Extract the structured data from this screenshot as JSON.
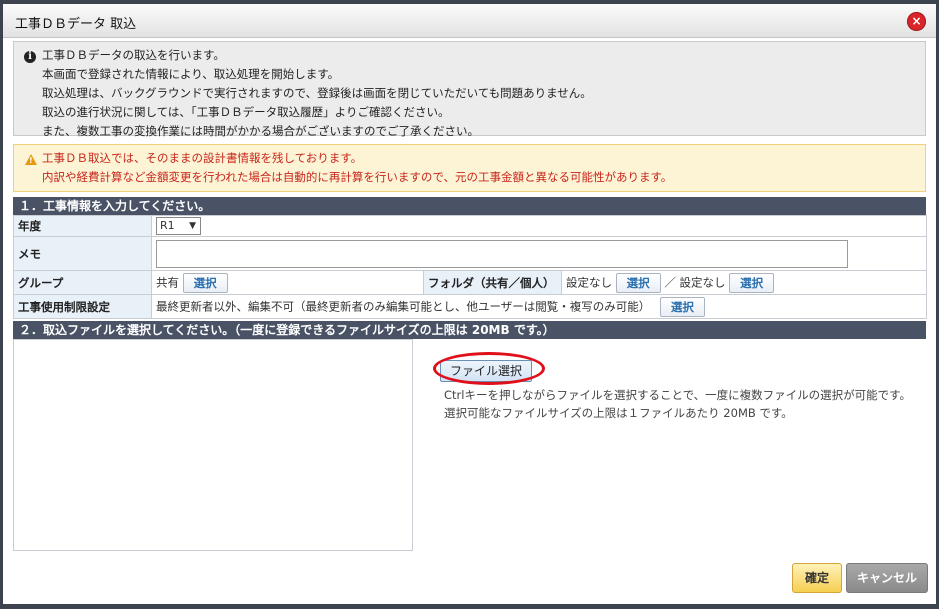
{
  "window": {
    "title": "工事ＤＢデータ 取込",
    "close_icon": "×"
  },
  "info": {
    "lines": [
      "工事ＤＢデータの取込を行います。",
      "本画面で登録された情報により、取込処理を開始します。",
      "取込処理は、バックグラウンドで実行されますので、登録後は画面を閉じていただいても問題ありません。",
      "取込の進行状況に関しては、「工事ＤＢデータ取込履歴」よりご確認ください。",
      "また、複数工事の変換作業には時間がかかる場合がございますのでご了承ください。"
    ]
  },
  "warning": {
    "lines": [
      "工事ＤＢ取込では、そのままの設計書情報を残しております。",
      "内訳や経費計算など金額変更を行われた場合は自動的に再計算を行いますので、元の工事金額と異なる可能性があります。"
    ]
  },
  "section1": {
    "header": "１．工事情報を入力してください。",
    "year_label": "年度",
    "year_value": "R1",
    "memo_label": "メモ",
    "memo_value": "",
    "group_label": "グループ",
    "group_value": "共有",
    "group_button": "選択",
    "folder_label": "フォルダ（共有／個人）",
    "folder_shared_value": "設定なし",
    "folder_shared_button": "選択",
    "folder_sep": "／",
    "folder_personal_value": "設定なし",
    "folder_personal_button": "選択",
    "restrict_label": "工事使用制限設定",
    "restrict_value": "最終更新者以外、編集不可（最終更新者のみ編集可能とし、他ユーザーは閲覧・複写のみ可能）",
    "restrict_button": "選択"
  },
  "section2": {
    "header": "２．取込ファイルを選択してください。（一度に登録できるファイルサイズの上限は 20MB です。）",
    "file_button": "ファイル選択",
    "note": "Ctrlキーを押しながらファイルを選択することで、一度に複数ファイルの選択が可能です。選択可能なファイルサイズの上限は１ファイルあたり 20MB です。"
  },
  "footer": {
    "ok": "確定",
    "cancel": "キャンセル"
  },
  "colors": {
    "header_bg": "#4a5366",
    "warn_text": "#c8261c",
    "highlight": "#e0101a"
  }
}
